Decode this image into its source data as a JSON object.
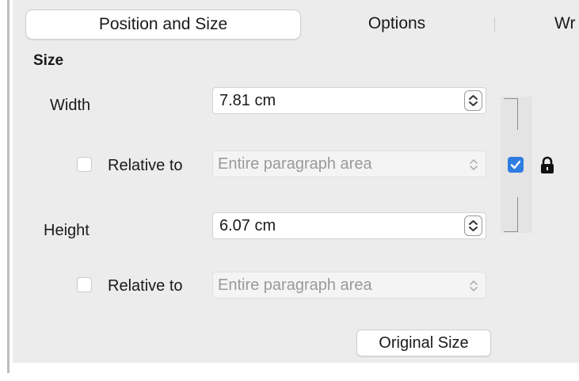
{
  "tabs": [
    {
      "label": "Position and Size",
      "active": true
    },
    {
      "label": "Options",
      "active": false
    },
    {
      "label": "Wr",
      "active": false
    }
  ],
  "size_section": {
    "title": "Size",
    "width": {
      "label": "Width",
      "value": "7.81 cm"
    },
    "width_relative": {
      "checkbox_label": "Relative to",
      "checked": false,
      "option": "Entire paragraph area"
    },
    "height": {
      "label": "Height",
      "value": "6.07 cm"
    },
    "height_relative": {
      "checkbox_label": "Relative to",
      "checked": false,
      "option": "Entire paragraph area"
    },
    "keep_ratio_checked": true,
    "lock_icon": "lock-icon",
    "original_size_button": "Original Size"
  },
  "colors": {
    "accent": "#2f7de1",
    "panel": "#ececec"
  }
}
